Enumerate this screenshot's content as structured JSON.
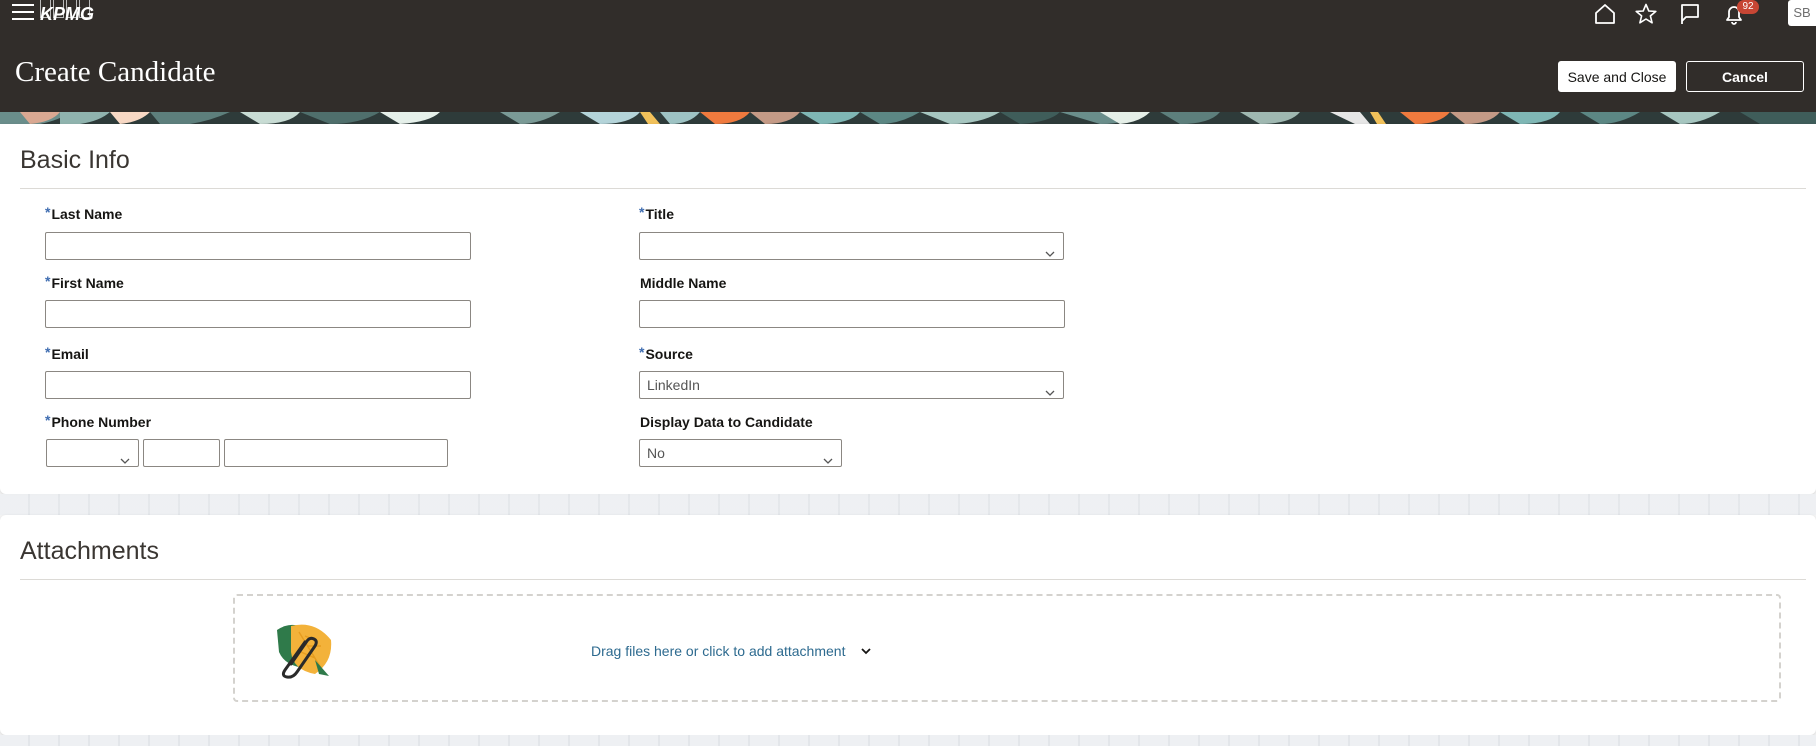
{
  "header": {
    "logo_text": "KPMG",
    "page_title": "Create Candidate",
    "notification_count": "92",
    "avatar_initials": "SB",
    "save_close_label": "Save and Close",
    "cancel_label": "Cancel"
  },
  "basic_info": {
    "section_title": "Basic Info",
    "required_marker": "*",
    "fields": {
      "last_name": {
        "label": "Last Name",
        "value": ""
      },
      "first_name": {
        "label": "First Name",
        "value": ""
      },
      "email": {
        "label": "Email",
        "value": ""
      },
      "phone_number": {
        "label": "Phone Number",
        "country_code": "",
        "area_code": "",
        "number": ""
      },
      "title": {
        "label": "Title",
        "value": ""
      },
      "middle_name": {
        "label": "Middle Name",
        "value": ""
      },
      "source": {
        "label": "Source",
        "value": "LinkedIn"
      },
      "display_data": {
        "label": "Display Data to Candidate",
        "value": "No"
      }
    }
  },
  "attachments": {
    "section_title": "Attachments",
    "drop_text": "Drag files here or click to add attachment"
  },
  "colors": {
    "header_bg": "#312d2a",
    "required_marker": "#3f6db1",
    "link_text": "#2d6a8f",
    "badge": "#c74634"
  },
  "icons": [
    "hamburger-menu-icon",
    "home-icon",
    "star-icon",
    "flag-icon",
    "bell-icon",
    "chevron-down-icon",
    "attachment-leaf-icon"
  ]
}
